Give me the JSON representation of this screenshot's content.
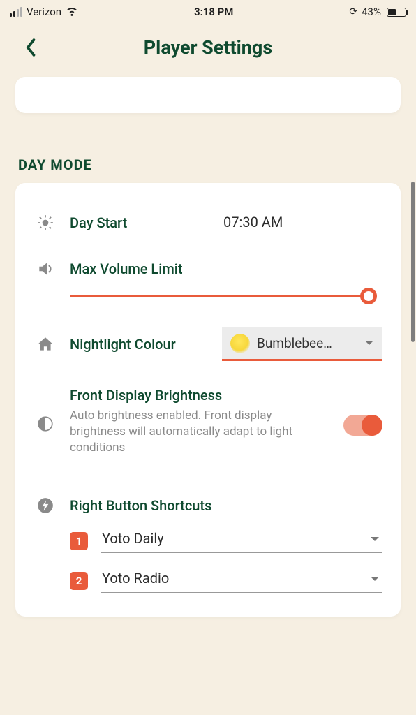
{
  "status": {
    "carrier": "Verizon",
    "time": "3:18 PM",
    "battery_pct": "43%"
  },
  "header": {
    "title": "Player Settings"
  },
  "section": {
    "title": "DAY MODE"
  },
  "day_start": {
    "label": "Day Start",
    "value": "07:30 AM"
  },
  "max_volume": {
    "label": "Max Volume Limit",
    "value_pct": 100
  },
  "nightlight": {
    "label": "Nightlight Colour",
    "selected": "Bumblebee…",
    "swatch_color": "#f7d73c"
  },
  "brightness": {
    "label": "Front Display Brightness",
    "description": "Auto brightness enabled. Front display brightness will automatically adapt to light conditions",
    "enabled": true
  },
  "shortcuts": {
    "label": "Right Button Shortcuts",
    "items": [
      {
        "num": "1",
        "value": "Yoto Daily"
      },
      {
        "num": "2",
        "value": "Yoto Radio"
      }
    ]
  }
}
